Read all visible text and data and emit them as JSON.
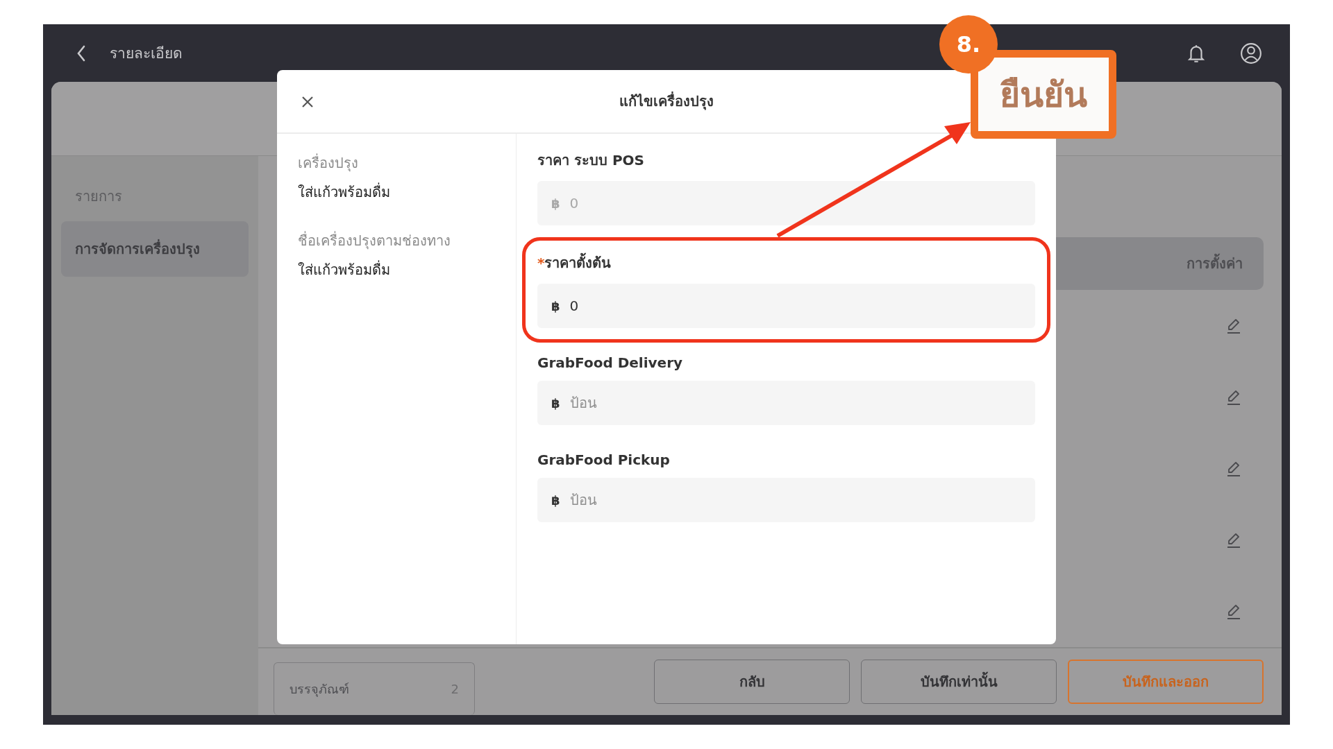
{
  "top_bar": {
    "title": "รายละเอียด"
  },
  "sidebar": {
    "heading": "รายการ",
    "items": [
      {
        "label": "การจัดการเครื่องปรุง",
        "selected": true
      }
    ]
  },
  "table": {
    "header": "การตั้งค่า"
  },
  "footer": {
    "card": {
      "label": "บรรจุภัณฑ์",
      "count": "2"
    },
    "buttons": [
      {
        "label": "กลับ",
        "kind": "outline"
      },
      {
        "label": "บันทึกเท่านั้น",
        "kind": "outline"
      },
      {
        "label": "บันทึกและออก",
        "kind": "primary"
      }
    ]
  },
  "modal": {
    "title": "แก้ไขเครื่องปรุง",
    "info": [
      {
        "label": "เครื่องปรุง",
        "value": "ใส่แก้วพร้อมดื่ม"
      },
      {
        "label": "ชื่อเครื่องปรุงตามช่องทาง",
        "value": "ใส่แก้วพร้อมดื่ม"
      }
    ],
    "fields": [
      {
        "label": "ราคา ระบบ POS",
        "currency": "฿",
        "value": "0",
        "disabled": true,
        "highlighted": false
      },
      {
        "label": "ราคาตั้งต้น",
        "required_mark": "*",
        "currency": "฿",
        "value": "0",
        "disabled": false,
        "highlighted": true
      },
      {
        "label": "GrabFood Delivery",
        "currency": "฿",
        "placeholder": "ป้อน",
        "disabled": false,
        "highlighted": false
      },
      {
        "label": "GrabFood Pickup",
        "currency": "฿",
        "placeholder": "ป้อน",
        "disabled": false,
        "highlighted": false
      }
    ]
  },
  "annotation": {
    "step": "8.",
    "callout": "ยืนยัน"
  }
}
